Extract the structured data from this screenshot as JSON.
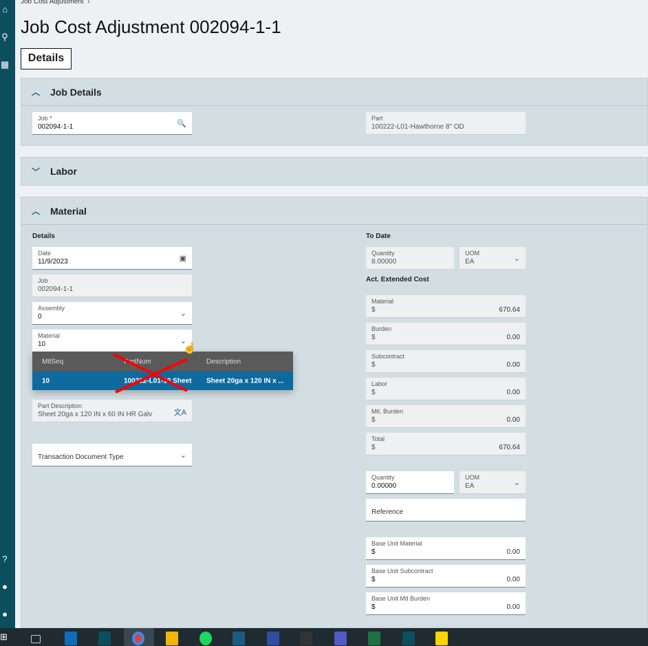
{
  "breadcrumb": "Job Cost Adjustment",
  "title": "Job Cost Adjustment 002094-1-1",
  "details_button": "Details",
  "job_details": {
    "header": "Job Details",
    "job_label": "Job *",
    "job_value": "002094-1-1",
    "part_label": "Part",
    "part_value": "100222-L01-Hawthorne 8\" OD"
  },
  "labor": {
    "header": "Labor"
  },
  "material": {
    "header": "Material",
    "details_label": "Details",
    "date_label": "Date",
    "date_value": "11/9/2023",
    "job_label": "Job",
    "job_value": "002094-1-1",
    "assembly_label": "Assembly",
    "assembly_value": "0",
    "material_label": "Material",
    "material_value": "10",
    "partdesc_label": "Part Description",
    "partdesc_value": "Sheet 20ga x 120 IN x  60 IN HR Galv",
    "trans_doc_label": "Transaction Document Type",
    "to_date_label": "To Date",
    "qty_label": "Quantity",
    "qty_value": "8.00000",
    "uom_label": "UOM",
    "uom_value": "EA",
    "act_ext_label": "Act. Extended Cost",
    "costs": [
      {
        "label": "Material",
        "cur": "$",
        "value": "670.64"
      },
      {
        "label": "Burden",
        "cur": "$",
        "value": "0.00"
      },
      {
        "label": "Subcontract",
        "cur": "$",
        "value": "0.00"
      },
      {
        "label": "Labor",
        "cur": "$",
        "value": "0.00"
      },
      {
        "label": "Mtl. Burden",
        "cur": "$",
        "value": "0.00"
      },
      {
        "label": "Total",
        "cur": "$",
        "value": "670.64"
      }
    ],
    "qty2_label": "Quantity",
    "qty2_value": "0.00000",
    "uom2_label": "UOM",
    "uom2_value": "EA",
    "reference_label": "Reference",
    "base": [
      {
        "label": "Base Unit Material",
        "cur": "$",
        "value": "0.00"
      },
      {
        "label": "Base Unit Subcontract",
        "cur": "$",
        "value": "0.00"
      },
      {
        "label": "Base Unit Mtl Burden",
        "cur": "$",
        "value": "0.00"
      }
    ]
  },
  "dropdown": {
    "headers": [
      "MtlSeq",
      "PartNum",
      "Description"
    ],
    "row": [
      "10",
      "100222-L01-10 Sheet",
      "Sheet 20ga x 120 IN x ..."
    ]
  },
  "colors": {
    "sidebar": "#0b4f5f",
    "selected_row": "#0e6a9e",
    "annotation": "#ff0000"
  }
}
